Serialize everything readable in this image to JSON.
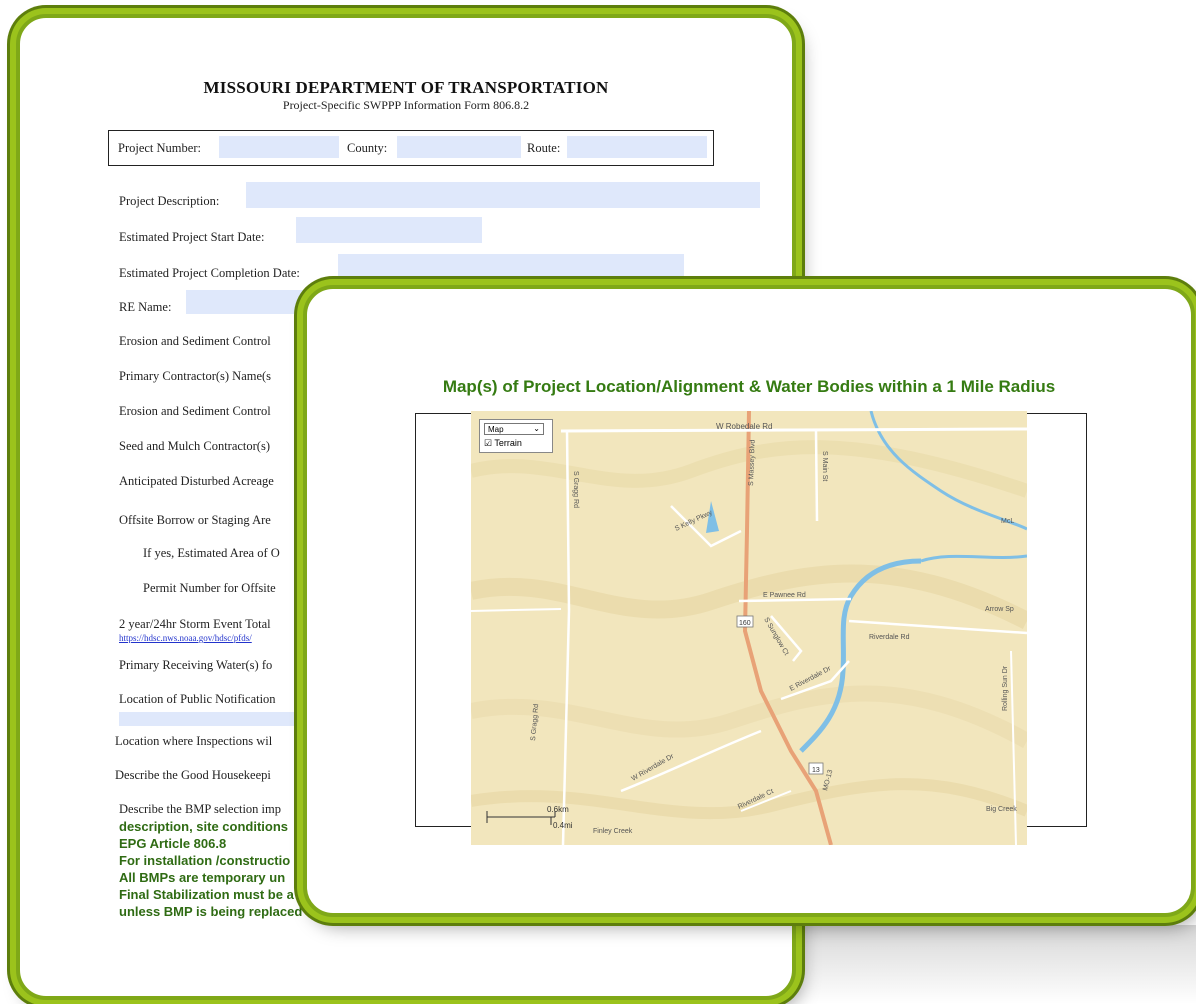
{
  "document": {
    "title": "MISSOURI DEPARTMENT OF TRANSPORTATION",
    "subtitle": "Project-Specific SWPPP Information Form 806.8.2",
    "header_fields": {
      "project_number": "Project Number:",
      "county": "County:",
      "route": "Route:"
    },
    "fields": [
      "Project Description:",
      "Estimated Project Start Date:",
      "Estimated Project Completion Date:",
      "RE Name:",
      "Erosion and Sediment Control",
      "Primary Contractor(s) Name(s",
      "Erosion and Sediment Control",
      "Seed and Mulch Contractor(s)",
      "Anticipated Disturbed Acreage",
      "Offsite Borrow or Staging Are",
      "If yes, Estimated Area of O",
      "Permit Number for Offsite",
      "2 year/24hr Storm Event Total",
      "Primary Receiving Water(s) fo",
      "Location of Public Notification",
      "Location where Inspections wil",
      "Describe the Good Housekeepi",
      "Describe the BMP selection imp"
    ],
    "link": "https://hdsc.nws.noaa.gov/hdsc/pfds/",
    "green_notes": [
      "description, site conditions",
      "EPG Article 806.8",
      "For installation /constructio",
      "All BMPs are temporary un",
      "Final Stabilization must be a",
      "unless BMP is being replaced with another interim stabilization BMP."
    ]
  },
  "map_slide": {
    "title": "Map(s) of Project Location/Alignment & Water Bodies within a 1 Mile Radius",
    "map_type_selected": "Map",
    "terrain_label": "Terrain",
    "terrain_checked": true,
    "scale_km": "0.6km",
    "scale_mi": "0.4mi",
    "roads": {
      "w_robedale": "W Robedale Rd",
      "s_gragg": "S Gragg Rd",
      "s_massey": "S Massey Blvd",
      "s_main": "S Main St",
      "s_kelly": "S Kelly Pkwy",
      "e_pawnee": "E Pawnee Rd",
      "s_sunglow": "S Sunglow Ct",
      "riverdale": "Riverdale Rd",
      "e_riverdale": "E Riverdale Dr",
      "w_riverdale": "W Riverdale Dr",
      "riverdale_ct": "Riverdale Ct",
      "s_gragg_rd_2": "S Gragg Rd",
      "arrow_sp": "Arrow Sp",
      "mcl": "McL",
      "finley_creek": "Finley Creek",
      "mo13": "MO-13",
      "hwy160": "160",
      "hwy13": "13",
      "rollingsun": "Rolling Sun Dr",
      "hill_creek": "Big Creek"
    },
    "colors": {
      "terrain": "#f2e6bd",
      "water": "#7fbfe6",
      "highway": "#e8a277",
      "accent_green": "#357b12"
    }
  }
}
